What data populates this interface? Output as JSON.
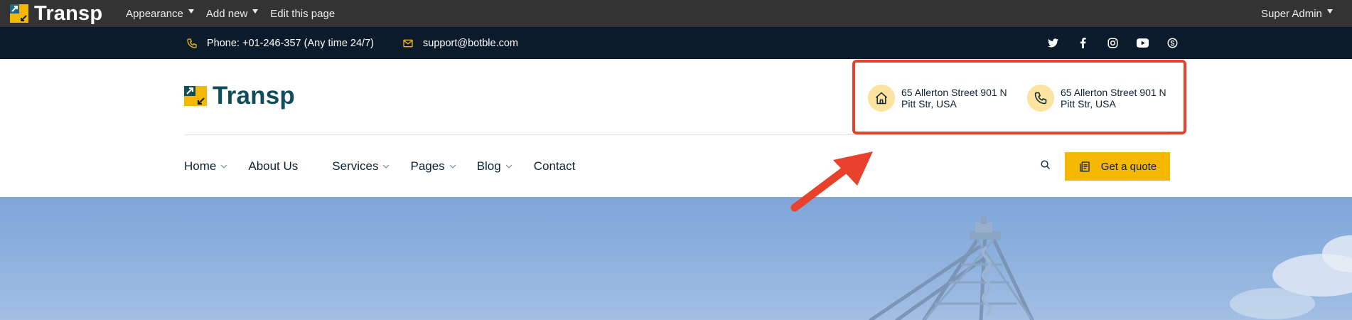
{
  "admin_bar": {
    "brand": "Transp",
    "menu": [
      {
        "label": "Appearance",
        "has_caret": true
      },
      {
        "label": "Add new",
        "has_caret": true
      },
      {
        "label": "Edit this page",
        "has_caret": false
      }
    ],
    "user": "Super Admin",
    "user_caret": true
  },
  "top_bar": {
    "phone": {
      "icon": "phone-icon",
      "text": "Phone: +01-246-357 (Any time 24/7)"
    },
    "email": {
      "icon": "mail-icon",
      "text": "support@botble.com"
    },
    "socials": [
      "twitter-icon",
      "facebook-icon",
      "instagram-icon",
      "youtube-icon",
      "skype-icon"
    ]
  },
  "header": {
    "brand": "Transp",
    "contacts": [
      {
        "icon": "home-icon",
        "text": "65 Allerton Street 901 N Pitt Str, USA"
      },
      {
        "icon": "phone-icon",
        "text": "65 Allerton Street 901 N Pitt Str, USA"
      }
    ]
  },
  "nav": {
    "items": [
      {
        "label": "Home",
        "has_dropdown": true
      },
      {
        "label": "About Us",
        "has_dropdown": false
      },
      {
        "label": "Services",
        "has_dropdown": true
      },
      {
        "label": "Pages",
        "has_dropdown": true
      },
      {
        "label": "Blog",
        "has_dropdown": true
      },
      {
        "label": "Contact",
        "has_dropdown": false
      }
    ],
    "search_icon": "search-icon",
    "quote_button": {
      "label": "Get a quote",
      "icon": "clipboard-icon"
    }
  },
  "colors": {
    "admin_bar_bg": "#333333",
    "top_bar_bg": "#0c1b2b",
    "accent": "#f5b800",
    "brand_text": "#0f4c5c",
    "annotation": "#e8412c"
  }
}
